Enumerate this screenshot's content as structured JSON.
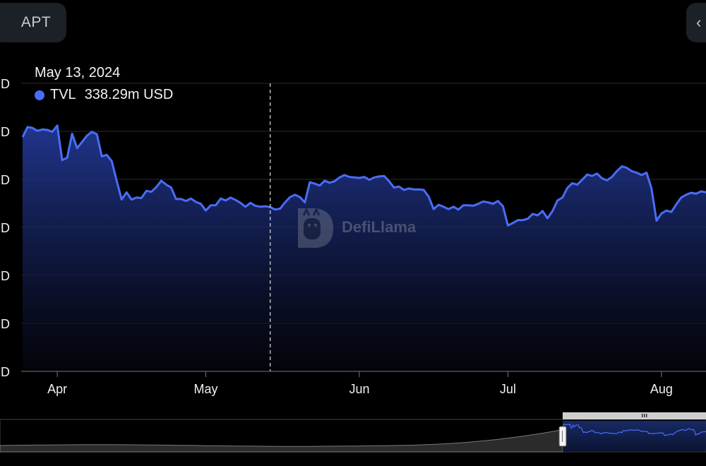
{
  "header": {
    "asset_label": "APT",
    "right_button_icon": "chevron-left-icon"
  },
  "tooltip": {
    "date": "May 13, 2024",
    "series": "TVL",
    "value": "338.29m USD"
  },
  "watermark": {
    "text": "DefiLlama",
    "icon": "llama-icon"
  },
  "colors": {
    "line": "#4a6cf7",
    "area_top": "#243b9c",
    "background": "#000000",
    "grid": "#2a2a2a"
  },
  "chart_data": {
    "type": "area",
    "x_tick_labels": [
      "Apr",
      "May",
      "Jun",
      "Jul",
      "Aug"
    ],
    "y_tick_labels": [
      "D",
      "D",
      "D",
      "D",
      "D",
      "D",
      "D"
    ],
    "x_tick_days": [
      17,
      47,
      78,
      108,
      139
    ],
    "x_range_days": [
      10,
      148
    ],
    "y_range": [
      0,
      6
    ],
    "grid": "horizontal",
    "legend": "top-left",
    "cursor_day": 60,
    "series": [
      {
        "name": "TVL",
        "x": [
          10,
          11,
          12,
          13,
          14,
          15,
          16,
          17,
          18,
          19,
          20,
          21,
          22,
          23,
          24,
          25,
          26,
          27,
          28,
          29,
          30,
          31,
          32,
          33,
          34,
          35,
          36,
          37,
          38,
          39,
          40,
          41,
          42,
          43,
          44,
          45,
          46,
          47,
          48,
          49,
          50,
          51,
          52,
          53,
          54,
          55,
          56,
          57,
          58,
          59,
          60,
          61,
          62,
          63,
          64,
          65,
          66,
          67,
          68,
          69,
          70,
          71,
          72,
          73,
          74,
          75,
          76,
          77,
          78,
          79,
          80,
          81,
          82,
          83,
          84,
          85,
          86,
          87,
          88,
          89,
          90,
          91,
          92,
          93,
          94,
          95,
          96,
          97,
          98,
          99,
          100,
          101,
          102,
          103,
          104,
          105,
          106,
          107,
          108,
          109,
          110,
          111,
          112,
          113,
          114,
          115,
          116,
          117,
          118,
          119,
          120,
          121,
          122,
          123,
          124,
          125,
          126,
          127,
          128,
          129,
          130,
          131,
          132,
          133,
          134,
          135,
          136,
          137,
          138,
          139,
          140,
          141,
          142,
          143,
          144,
          145,
          146,
          147,
          148
        ],
        "values": [
          4.88,
          5.09,
          5.07,
          5.01,
          5.04,
          5.03,
          4.99,
          5.12,
          4.4,
          4.45,
          4.95,
          4.65,
          4.78,
          4.91,
          4.99,
          4.94,
          4.48,
          4.51,
          4.38,
          3.97,
          3.58,
          3.73,
          3.58,
          3.62,
          3.61,
          3.76,
          3.74,
          3.84,
          3.97,
          3.89,
          3.83,
          3.59,
          3.59,
          3.55,
          3.6,
          3.53,
          3.49,
          3.35,
          3.46,
          3.46,
          3.6,
          3.56,
          3.62,
          3.57,
          3.51,
          3.43,
          3.51,
          3.45,
          3.43,
          3.44,
          3.42,
          3.37,
          3.39,
          3.52,
          3.63,
          3.68,
          3.63,
          3.52,
          3.94,
          3.91,
          3.87,
          3.97,
          3.93,
          3.96,
          4.04,
          4.09,
          4.05,
          4.04,
          4.03,
          4.05,
          3.99,
          4.04,
          4.06,
          4.07,
          3.96,
          3.83,
          3.85,
          3.78,
          3.81,
          3.79,
          3.79,
          3.78,
          3.64,
          3.38,
          3.47,
          3.43,
          3.38,
          3.43,
          3.37,
          3.46,
          3.46,
          3.45,
          3.49,
          3.54,
          3.52,
          3.49,
          3.55,
          3.44,
          3.04,
          3.09,
          3.15,
          3.15,
          3.18,
          3.28,
          3.25,
          3.34,
          3.19,
          3.34,
          3.56,
          3.62,
          3.82,
          3.92,
          3.89,
          3.99,
          4.1,
          4.07,
          4.12,
          4.02,
          3.98,
          4.05,
          4.17,
          4.27,
          4.24,
          4.17,
          4.14,
          4.09,
          4.14,
          3.81,
          3.14,
          3.29,
          3.35,
          3.32,
          3.48,
          3.62,
          3.68,
          3.72,
          3.7,
          3.75,
          3.73
        ]
      }
    ]
  },
  "navigator": {
    "handle_icon": "grip-lines-icon"
  }
}
